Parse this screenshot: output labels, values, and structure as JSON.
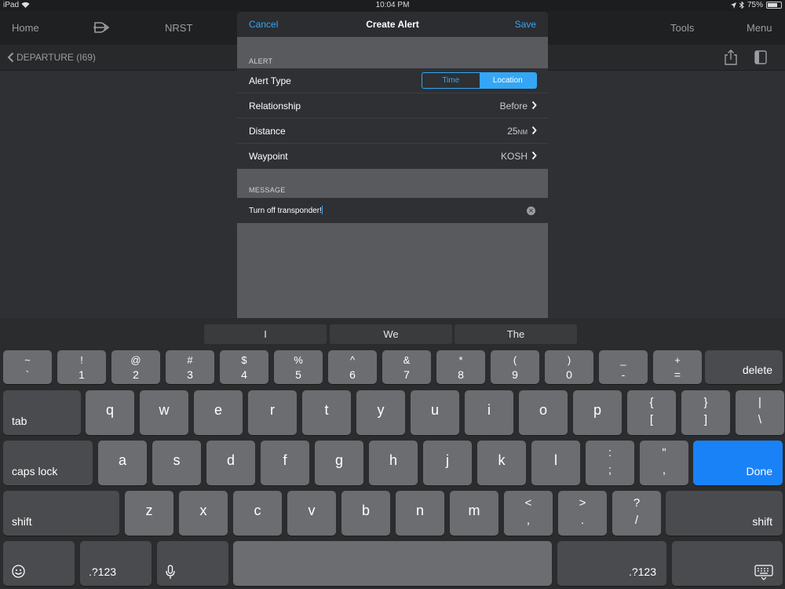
{
  "status_bar": {
    "device": "iPad",
    "time": "10:04 PM",
    "battery": "75%",
    "battery_level": 0.75
  },
  "nav": {
    "home": "Home",
    "nrst": "NRST",
    "tools": "Tools",
    "menu": "Menu"
  },
  "subbar": {
    "back": "DEPARTURE (I69)"
  },
  "modal": {
    "cancel": "Cancel",
    "title": "Create Alert",
    "save": "Save",
    "alert_section": "ALERT",
    "alert_type_label": "Alert Type",
    "seg_time": "Time",
    "seg_location": "Location",
    "selected_alert_type": "Location",
    "relationship_label": "Relationship",
    "relationship_value": "Before",
    "distance_label": "Distance",
    "distance_value": "25",
    "distance_unit": "NM",
    "waypoint_label": "Waypoint",
    "waypoint_value": "KOSH",
    "message_section": "MESSAGE",
    "message_value": "Turn off transponder!"
  },
  "keyboard": {
    "suggestions": [
      "I",
      "We",
      "The"
    ],
    "row1": [
      [
        "~",
        "`"
      ],
      [
        "!",
        "1"
      ],
      [
        "@",
        "2"
      ],
      [
        "#",
        "3"
      ],
      [
        "$",
        "4"
      ],
      [
        "%",
        "5"
      ],
      [
        "^",
        "6"
      ],
      [
        "&",
        "7"
      ],
      [
        "*",
        "8"
      ],
      [
        "(",
        "9"
      ],
      [
        ")",
        "0"
      ],
      [
        "_",
        "-"
      ],
      [
        "+",
        "="
      ]
    ],
    "delete": "delete",
    "tab": "tab",
    "row2": [
      "q",
      "w",
      "e",
      "r",
      "t",
      "y",
      "u",
      "i",
      "o",
      "p"
    ],
    "row2_sym": [
      [
        "{",
        "["
      ],
      [
        "}",
        "]"
      ],
      [
        "|",
        "\\"
      ]
    ],
    "caps_lock": "caps lock",
    "row3": [
      "a",
      "s",
      "d",
      "f",
      "g",
      "h",
      "j",
      "k",
      "l"
    ],
    "row3_sym": [
      [
        ":",
        ";"
      ],
      [
        "\"",
        ","
      ]
    ],
    "done": "Done",
    "shift": "shift",
    "row4": [
      "z",
      "x",
      "c",
      "v",
      "b",
      "n",
      "m"
    ],
    "row4_sym": [
      [
        "<",
        ","
      ],
      [
        ">",
        "."
      ],
      [
        "?",
        "/"
      ]
    ],
    "num_switch": ".?123",
    "emoji_icon": "emoji-icon",
    "mic_icon": "mic-icon",
    "hide_keyboard_icon": "keyboard-hide-icon"
  }
}
